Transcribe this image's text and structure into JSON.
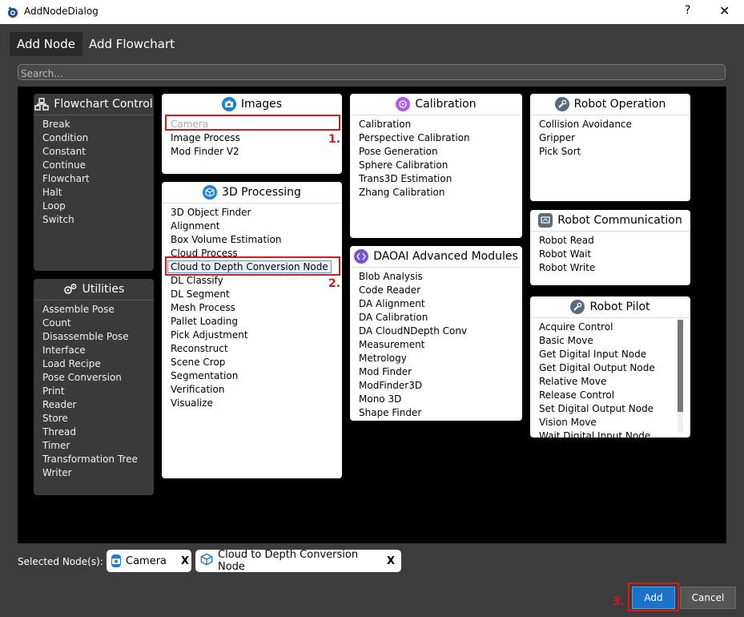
{
  "window": {
    "title": "AddNodeDialog",
    "help_glyph": "?",
    "close_glyph": "✕"
  },
  "tabs": [
    {
      "label": "Add Node",
      "active": true
    },
    {
      "label": "Add Flowchart",
      "active": false
    }
  ],
  "search": {
    "placeholder": "Search...",
    "value": ""
  },
  "cards": {
    "flowchart_control": {
      "title": "Flowchart Control",
      "items": [
        "Break",
        "Condition",
        "Constant",
        "Continue",
        "Flowchart",
        "Halt",
        "Loop",
        "Switch"
      ]
    },
    "utilities": {
      "title": "Utilities",
      "items": [
        "Assemble Pose",
        "Count",
        "Disassemble Pose",
        "Interface",
        "Load Recipe",
        "Pose Conversion",
        "Print",
        "Reader",
        "Store",
        "Thread",
        "Timer",
        "Transformation Tree",
        "Writer"
      ]
    },
    "images": {
      "title": "Images",
      "items": [
        "Camera",
        "Image Process",
        "Mod Finder V2"
      ]
    },
    "processing_3d": {
      "title": "3D Processing",
      "items": [
        "3D Object Finder",
        "Alignment",
        "Box Volume Estimation",
        "Cloud Process",
        "Cloud to Depth Conversion Node",
        "DL Classify",
        "DL Segment",
        "Mesh Process",
        "Pallet Loading",
        "Pick Adjustment",
        "Reconstruct",
        "Scene Crop",
        "Segmentation",
        "Verification",
        "Visualize"
      ]
    },
    "calibration": {
      "title": "Calibration",
      "items": [
        "Calibration",
        "Perspective Calibration",
        "Pose Generation",
        "Sphere Calibration",
        "Trans3D Estimation",
        "Zhang Calibration"
      ]
    },
    "daoai_advanced": {
      "title": "DAOAI Advanced Modules",
      "items": [
        "Blob Analysis",
        "Code Reader",
        "DA Alignment",
        "DA Calibration",
        "DA CloudNDepth Conv",
        "Measurement",
        "Metrology",
        "Mod Finder",
        "ModFinder3D",
        "Mono 3D",
        "Shape Finder"
      ]
    },
    "robot_operation": {
      "title": "Robot Operation",
      "items": [
        "Collision Avoidance",
        "Gripper",
        "Pick Sort"
      ]
    },
    "robot_communication": {
      "title": "Robot Communication",
      "items": [
        "Robot Read",
        "Robot Wait",
        "Robot Write"
      ]
    },
    "robot_pilot": {
      "title": "Robot Pilot",
      "items": [
        "Acquire Control",
        "Basic Move",
        "Get Digital Input Node",
        "Get Digital Output Node",
        "Relative Move",
        "Release Control",
        "Set Digital Output Node",
        "Vision Move",
        "Wait Digital Input Node"
      ]
    }
  },
  "annotations": {
    "m1": "1.",
    "m2": "2.",
    "m3": "3."
  },
  "selected": {
    "label": "Selected Node(s):",
    "chips": [
      {
        "label": "Camera",
        "remove": "X"
      },
      {
        "label": "Cloud to Depth Conversion Node",
        "remove": "X"
      }
    ]
  },
  "buttons": {
    "add": "Add",
    "cancel": "Cancel"
  },
  "colors": {
    "accent": "#1a73c9",
    "highlight": "#d41a1a",
    "images_icon": "#1f7fd1",
    "calibration_icon": "#b05ce6",
    "daoai_icon": "#7b4fd6",
    "robot_icon": "#5a6b7b"
  }
}
